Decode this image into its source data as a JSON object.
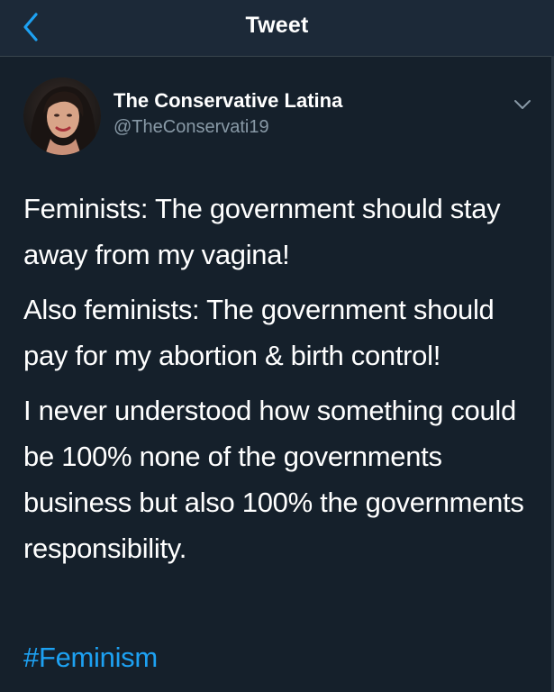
{
  "header": {
    "title": "Tweet",
    "back_icon": "chevron-left-icon"
  },
  "author": {
    "display_name": "The Conservative Latina",
    "handle": "@TheConservati19",
    "avatar": "profile-photo",
    "menu_icon": "chevron-down-icon"
  },
  "tweet": {
    "paragraphs": [
      "Feminists: The government should stay away from my vagina!",
      "Also feminists: The government should pay for my abortion & birth control!",
      "I never understood how something could be 100% none of the governments business but also 100% the governments responsibility."
    ],
    "hashtag": "#Feminism"
  },
  "colors": {
    "background": "#15202b",
    "header_background": "#1c2938",
    "text_primary": "#ffffff",
    "text_secondary": "#8899a6",
    "accent": "#1da1f2"
  }
}
